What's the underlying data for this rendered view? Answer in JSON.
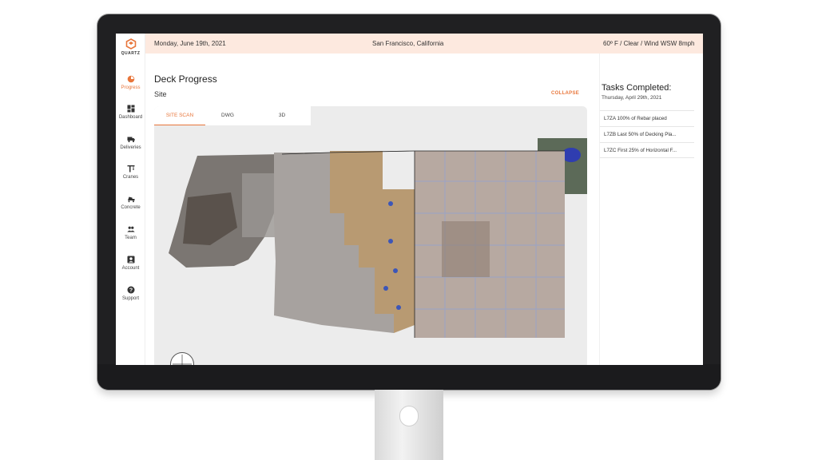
{
  "app": {
    "brand": "QUARTZ",
    "accent": "#e8763b",
    "header_bg": "#fde9df"
  },
  "header": {
    "date": "Monday, June 19th, 2021",
    "location": "San Francisco, California",
    "weather": "60º F / Clear / Wind WSW 8mph"
  },
  "sidebar": {
    "items": [
      {
        "label": "Progress",
        "icon": "progress-icon",
        "active": true
      },
      {
        "label": "Dashboard",
        "icon": "dashboard-icon"
      },
      {
        "label": "Deliveries",
        "icon": "truck-icon"
      },
      {
        "label": "Cranes",
        "icon": "crane-icon"
      },
      {
        "label": "Concrete",
        "icon": "concrete-mixer-icon"
      },
      {
        "label": "Team",
        "icon": "team-icon"
      },
      {
        "label": "Account",
        "icon": "account-icon"
      },
      {
        "label": "Support",
        "icon": "help-icon"
      }
    ]
  },
  "main": {
    "title": "Deck Progress",
    "subtitle": "Site",
    "collapse_label": "COLLAPSE",
    "tabs": [
      {
        "label": "SITE SCAN",
        "active": true
      },
      {
        "label": "DWG"
      },
      {
        "label": "3D"
      }
    ]
  },
  "tasks": {
    "title": "Tasks Completed:",
    "date": "Thursday, April 29th, 2021",
    "items": [
      {
        "text": "L7ZA 100% of Rebar placed"
      },
      {
        "text": "L7ZB Last 50% of Decking Pla..."
      },
      {
        "text": "L7ZC First 25% of Horizontal F..."
      }
    ]
  }
}
